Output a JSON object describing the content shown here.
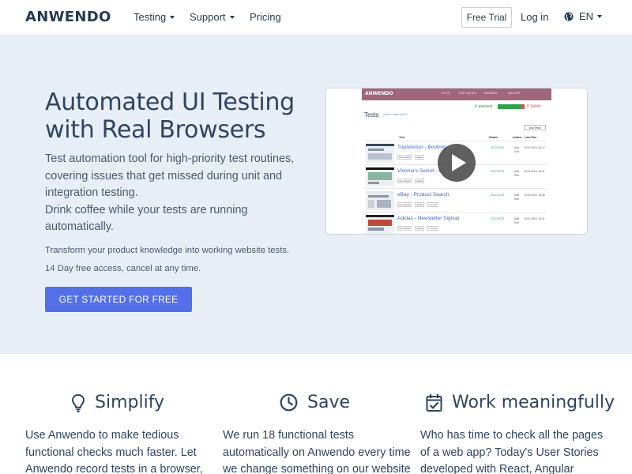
{
  "nav": {
    "logo": "ANWENDO",
    "links": [
      "Testing",
      "Support",
      "Pricing"
    ],
    "free_trial": "Free Trial",
    "login": "Log in",
    "lang": "EN"
  },
  "hero": {
    "title_line1": "Automated UI Testing",
    "title_line2": "with Real Browsers",
    "lead": "Test automation tool for high-priority test routines, covering issues that get missed during unit and integration testing.",
    "lead2": "Drink coffee while your tests are running automatically.",
    "note1": "Transform your product knowledge into working website tests.",
    "note2": "14 Day free access, cancel at any time.",
    "cta": "GET STARTED FOR FREE"
  },
  "video": {
    "app_logo": "ANWENDO",
    "app_menu": [
      "TESTS",
      "TEST SUITES",
      "RUNNING",
      "MASTER"
    ],
    "passed": "4 passed",
    "failed": "0 failed",
    "tests_title": "Tests",
    "tests_hint": "what to create a test?",
    "add_test": "Add Tests",
    "headers": [
      "Test",
      "Status",
      "Author",
      "Last Run"
    ],
    "rows": [
      {
        "title": "TripAdvisor - Booking",
        "status": "SUCCESS",
        "author": "Max Doe",
        "date": "19.01.2019, 16:12"
      },
      {
        "title": "Victoria's Secret - C",
        "status": "SUCCESS",
        "author": "Max Doe",
        "date": "19.01.2019, 16:01"
      },
      {
        "title": "eBay - Product Search",
        "status": "SUCCESS",
        "author": "Max Doe",
        "date": "19.01.2019, 15:55"
      },
      {
        "title": "Adidas - Newsletter Signup",
        "status": "SUCCESS",
        "author": "Max Doe",
        "date": "19.01.2019, 15:41"
      }
    ],
    "row_buttons": [
      "view details",
      "details",
      "run test"
    ]
  },
  "features": [
    {
      "title": "Simplify",
      "text": "Use Anwendo to make tedious functional checks much faster. Let Anwendo record tests in a browser, and replay"
    },
    {
      "title": "Save",
      "text": "We run 18 functional tests automatically on Anwendo every time we change something on our website and"
    },
    {
      "title": "Work meaningfully",
      "text": "Who has time to check all the pages of a web app? Today's User Stories developed with React, Angular"
    }
  ],
  "colors": {
    "accent": "#5470e8",
    "hero_bg": "#e8eef6",
    "text_dark": "#2f4461",
    "success": "#31a24c",
    "fail": "#d9534f"
  }
}
